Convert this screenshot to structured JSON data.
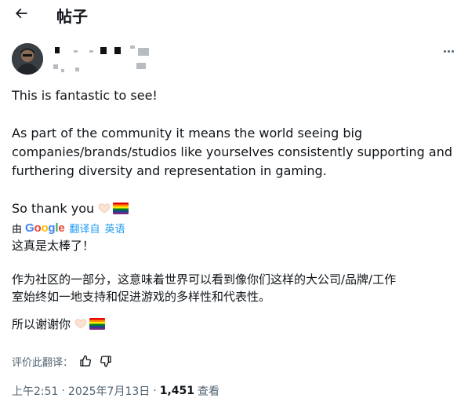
{
  "header": {
    "back_icon": "arrow-left-icon",
    "title": "帖子"
  },
  "post": {
    "avatar_icon": "user-avatar",
    "more_icon": "more-horizontal-icon",
    "original": {
      "line1": "This is fantastic to see!",
      "para2_line1": "As part of the community it means the world seeing big",
      "para2_line2": "companies/brands/studios like yourselves consistently supporting and",
      "para2_line3": "furthering diversity and representation in gaming.",
      "thanks": "So thank you"
    },
    "translation_bar": {
      "by": "由",
      "google": "Google",
      "translated_from": "翻译自",
      "language": "英语",
      "google_colors": [
        "#4285f4",
        "#ea4335",
        "#fbbc05",
        "#4285f4",
        "#34a853",
        "#ea4335"
      ]
    },
    "translated": {
      "line1": "这真是太棒了！",
      "para2_line1": "作为社区的一部分，这意味着世界可以看到像你们这样的大公司/品牌/工作",
      "para2_line2": "室始终如一地支持和促进游戏的多样性和代表性。",
      "thanks": "所以谢谢你"
    },
    "rate": {
      "label": "评价此翻译：",
      "thumbs_up_icon": "thumbs-up-icon",
      "thumbs_down_icon": "thumbs-down-icon"
    },
    "meta": {
      "time": "上午2:51",
      "separator": "·",
      "date": "2025年7月13日",
      "views": "1,451",
      "views_label": "查看"
    },
    "accent_color": "#1d9bf0"
  }
}
